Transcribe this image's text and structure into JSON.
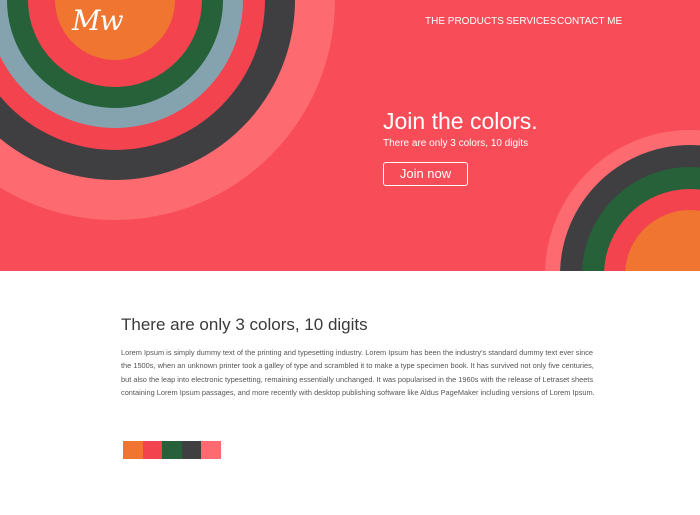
{
  "logo": {
    "text": "Mw"
  },
  "nav": {
    "items": [
      {
        "label": "THE PRODUCTS"
      },
      {
        "label": "SERVICES"
      },
      {
        "label": "CONTACT ME"
      }
    ]
  },
  "hero": {
    "title": "Join the colors.",
    "subtitle": "There are only 3 colors, 10 digits",
    "button_label": "Join now"
  },
  "content": {
    "title": "There are only 3 colors, 10 digits",
    "paragraph": "Lorem Ipsum is simply dummy text of the printing and typesetting industry. Lorem Ipsum has been the industry's standard dummy text ever since the 1500s, when an unknown printer took a galley of type and scrambled it to make a type specimen book. It has survived not only five centuries, but also the leap into electronic typesetting, remaining essentially unchanged. It was popularised in the 1960s with the release of Letraset sheets containing Lorem Ipsum passages, and more recently with desktop publishing software like Aldus PageMaker including versions of Lorem Ipsum."
  },
  "colors": {
    "hero_background": "#f84d58",
    "coral_light": "#fd6b70",
    "red": "#f3434f",
    "charcoal": "#3f3f41",
    "steel_blue": "#84a3af",
    "green": "#26613a",
    "orange": "#ef7530"
  },
  "swatches": [
    "#ef7530",
    "#f3434f",
    "#26613a",
    "#3f3f41",
    "#fd6b70"
  ]
}
